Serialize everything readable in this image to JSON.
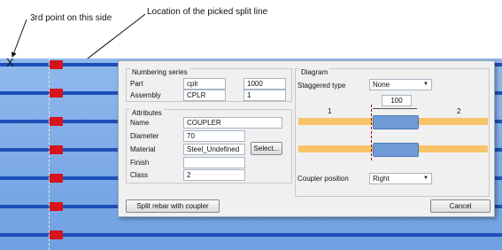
{
  "annotations": {
    "third_point": "3rd point on this side",
    "split_line": "Location of the picked split line",
    "x_marker": "X"
  },
  "dialog": {
    "numbering": {
      "title": "Numbering series",
      "part_label": "Part",
      "part_prefix": "cplr",
      "part_start": "1000",
      "assembly_label": "Assembly",
      "assembly_prefix": "CPLR",
      "assembly_start": "1"
    },
    "attributes": {
      "title": "Attributes",
      "name_label": "Name",
      "name_value": "COUPLER",
      "diameter_label": "Diameter",
      "diameter_value": "70",
      "material_label": "Material",
      "material_value": "Steel_Undefined",
      "select_button": "Select...",
      "finish_label": "Finish",
      "finish_value": "",
      "class_label": "Class",
      "class_value": "2"
    },
    "diagram": {
      "title": "Diagram",
      "staggered_label": "Staggered type",
      "staggered_value": "None",
      "offset_value": "100",
      "side1": "1",
      "side2": "2",
      "coupler_position_label": "Coupler position",
      "coupler_position_value": "Right"
    },
    "split_button": "Split rebar with coupler",
    "cancel_button": "Cancel"
  },
  "colors": {
    "model_bg": "#7aa8e8",
    "rebar": "#1d4fb8",
    "coupler": "#d6141c",
    "bar_orange": "#f8c46a",
    "coupler_block": "#6f9bd6"
  }
}
